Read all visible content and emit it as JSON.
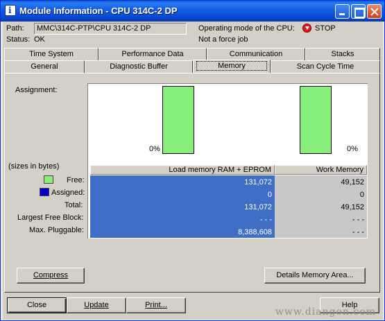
{
  "window": {
    "title": "Module Information - CPU 314C-2 DP"
  },
  "header": {
    "path_label": "Path:",
    "path_value": "MMC\\314C-PTP\\CPU 314C-2 DP",
    "status_label": "Status:",
    "status_value": "OK",
    "op_mode_label": "Operating mode of the CPU:",
    "op_mode_value": "STOP",
    "force_job": "Not a force job"
  },
  "tabs": {
    "row1": [
      "Time System",
      "Performance Data",
      "Communication",
      "Stacks"
    ],
    "row2": [
      "General",
      "Diagnostic Buffer",
      "Memory",
      "Scan Cycle Time"
    ],
    "active": "Memory"
  },
  "memory": {
    "assignment_label": "Assignment:",
    "sizes_label": "(sizes in bytes)",
    "legend_free": "Free:",
    "legend_assigned": "Assigned:",
    "row_total": "Total:",
    "row_largest": "Largest Free Block:",
    "row_max": "Max. Pluggable:",
    "col_load": "Load memory RAM + EPROM",
    "col_work": "Work Memory",
    "load": {
      "pct": "0%",
      "free": "131,072",
      "assigned": "0",
      "total": "131,072",
      "largest": "- - -",
      "max": "8,388,608"
    },
    "work": {
      "pct": "0%",
      "free": "49,152",
      "assigned": "0",
      "total": "49,152",
      "largest": "- - -",
      "max": "- - -"
    },
    "colors": {
      "free": "#88ee7a",
      "assigned": "#0000cc",
      "load_bg": "#3f6fc4",
      "work_bg": "#c8c8c8"
    }
  },
  "buttons": {
    "compress": "Compress",
    "details": "Details Memory Area...",
    "close": "Close",
    "update": "Update",
    "print": "Print...",
    "help": "Help"
  },
  "watermark": "www.diangon.com"
}
